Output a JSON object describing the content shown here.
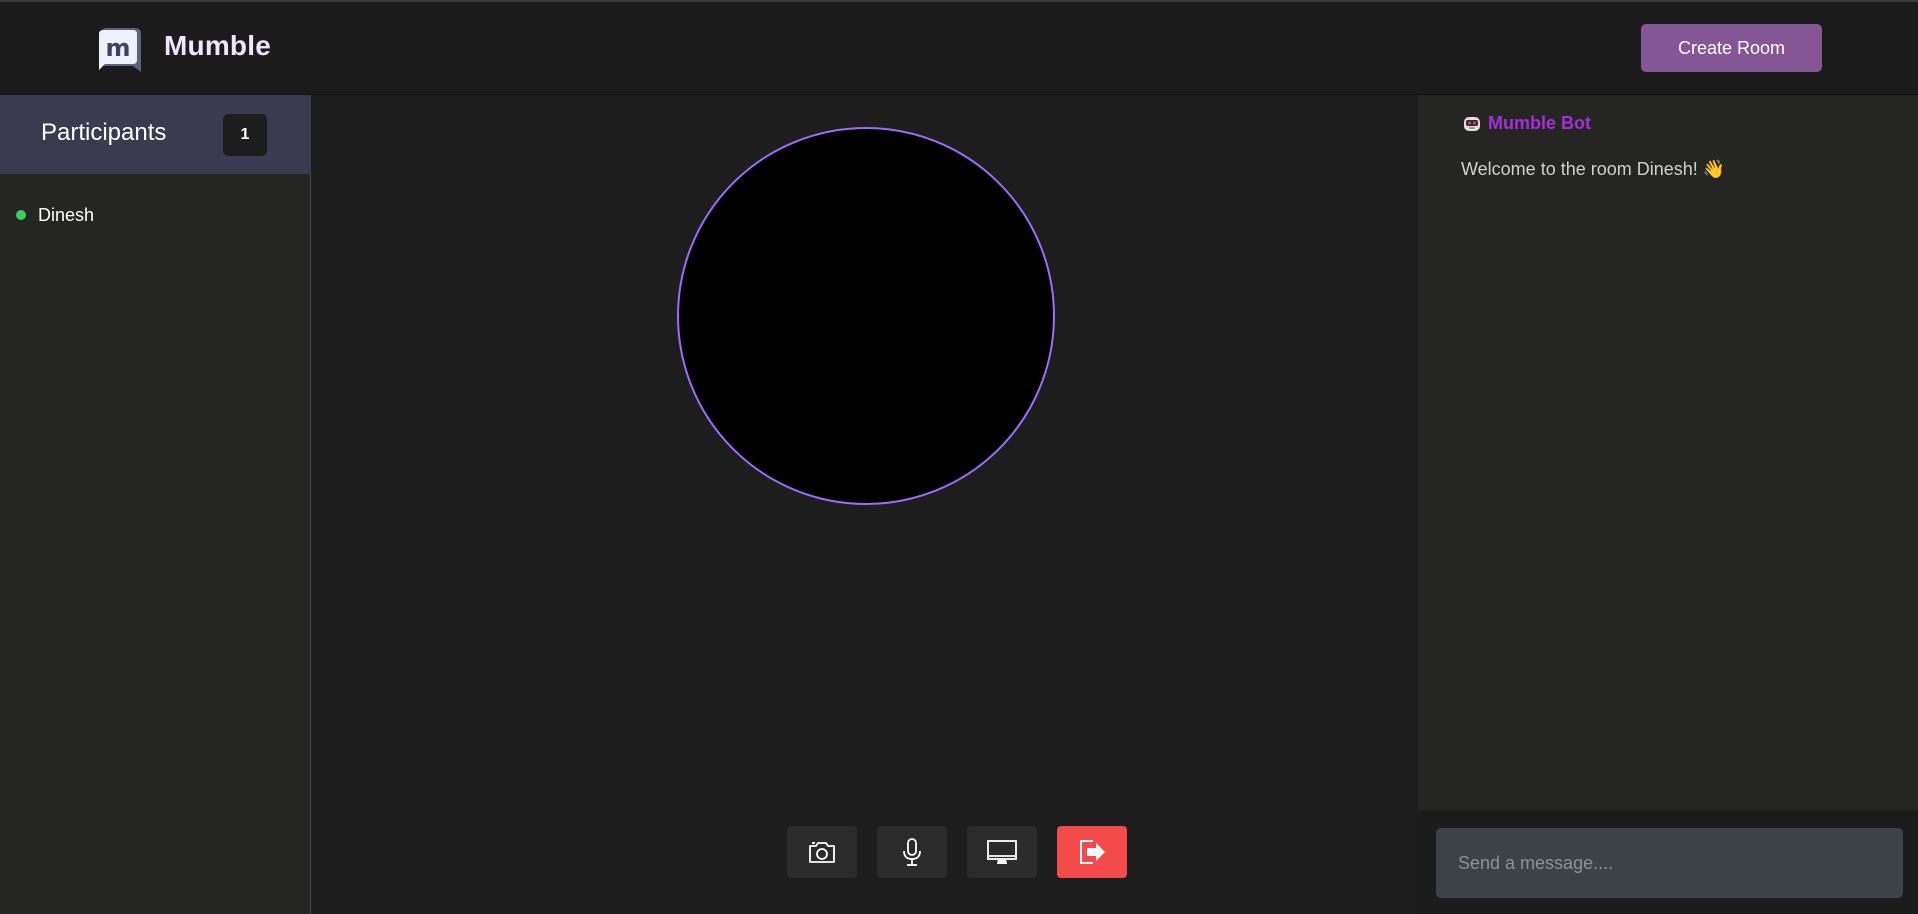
{
  "header": {
    "brand": "Mumble",
    "create_room_label": "Create Room",
    "logo_letter": "m"
  },
  "sidebar": {
    "title": "Participants",
    "count": "1",
    "participants": [
      {
        "name": "Dinesh",
        "status": "online",
        "status_color": "#3ad15a"
      }
    ]
  },
  "stage": {
    "ring_color": "#9e6bfb",
    "controls": [
      {
        "icon": "camera-icon"
      },
      {
        "icon": "microphone-icon"
      },
      {
        "icon": "screen-share-icon"
      },
      {
        "icon": "leave-icon",
        "color": "#f34a4a"
      }
    ]
  },
  "chat": {
    "messages": [
      {
        "sender": "Mumble Bot",
        "icon": "robot-icon",
        "sender_color": "#a42ed8",
        "text": "Welcome to the room Dinesh! 👋"
      }
    ],
    "input_placeholder": "Send a message...."
  },
  "colors": {
    "accent": "#845695",
    "participants_header": "#3b3b50",
    "background": "#1d1d1d"
  }
}
